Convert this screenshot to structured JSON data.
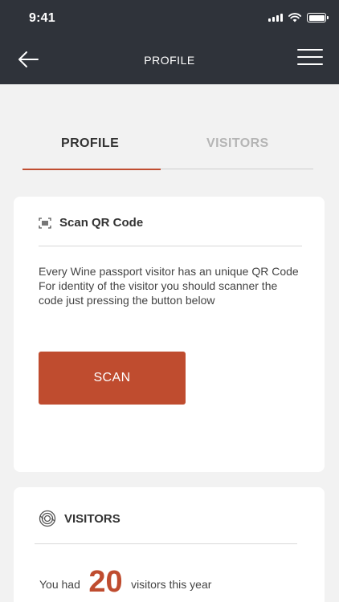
{
  "status_bar": {
    "time": "9:41"
  },
  "nav": {
    "title": "PROFILE"
  },
  "tabs": [
    {
      "label": "PROFILE",
      "active": true
    },
    {
      "label": "VISITORS",
      "active": false
    }
  ],
  "scan_card": {
    "title": "Scan QR Code",
    "description": "Every Wine passport visitor has an unique QR Code  For identity of the visitor you should scanner the code just pressing the button below",
    "button_label": "SCAN"
  },
  "visitors_card": {
    "title": "VISITORS",
    "prefix": "You had",
    "count": "20",
    "suffix": "visitors this year"
  },
  "colors": {
    "accent": "#bf4c2f",
    "header_bg": "#2f333a",
    "background": "#f2f2f2"
  },
  "icons": [
    "back-arrow-icon",
    "menu-icon",
    "qr-scan-icon",
    "visitors-icon",
    "signal-icon",
    "wifi-icon",
    "battery-icon"
  ]
}
